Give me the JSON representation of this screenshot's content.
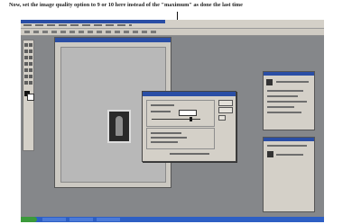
{
  "caption": "Now, set the image quality option to 9 or 10 here instead of the \"maximum\" as done the last time"
}
